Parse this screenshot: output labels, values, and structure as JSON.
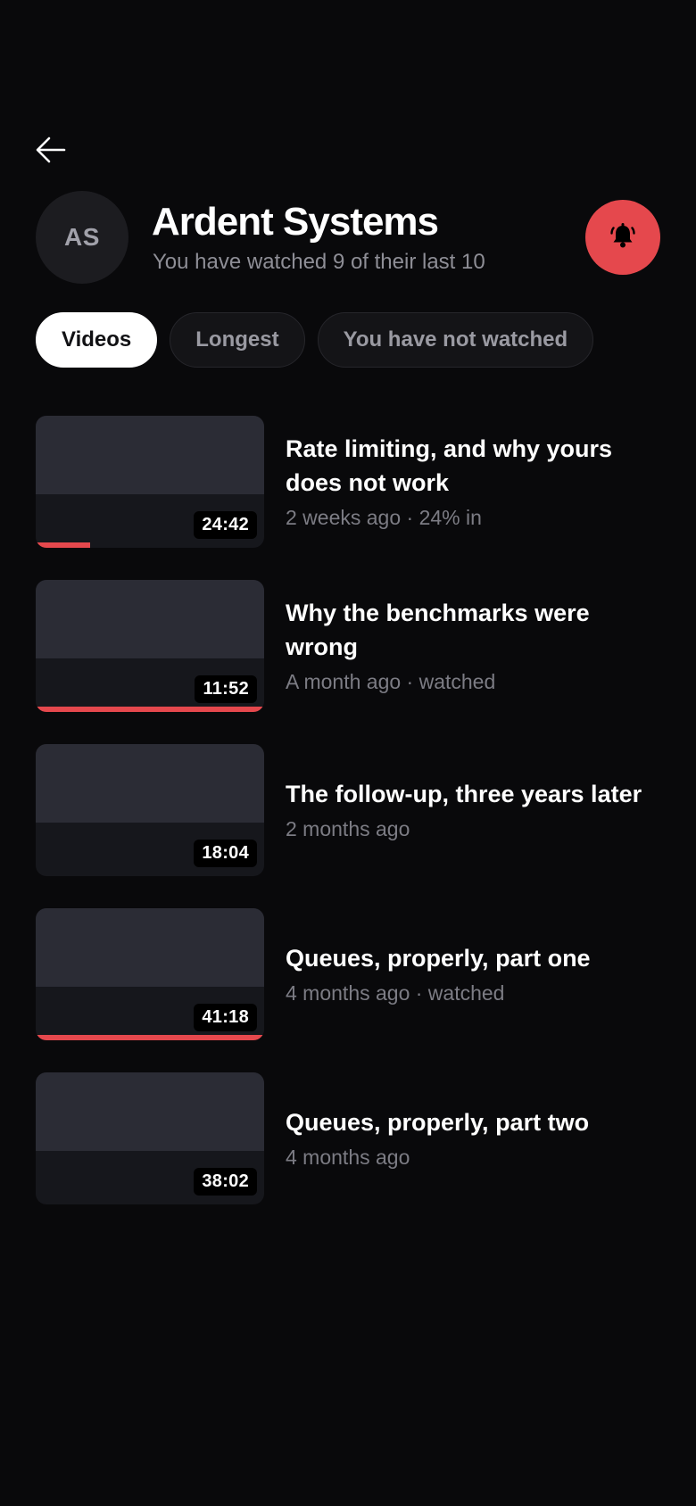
{
  "header": {
    "back_icon": "arrow-left-icon",
    "bell_icon": "bell-ringing-icon",
    "accent_color": "#e5484d"
  },
  "channel": {
    "initials": "AS",
    "name": "Ardent Systems",
    "subtitle": "You have watched 9 of their last 10"
  },
  "filters": {
    "chips": [
      {
        "label": "Videos",
        "active": true
      },
      {
        "label": "Longest",
        "active": false
      },
      {
        "label": "You have not watched",
        "active": false
      }
    ]
  },
  "videos": [
    {
      "title": "Rate limiting, and why yours does not work",
      "meta": "2 weeks ago · 24% in",
      "duration": "24:42",
      "progress": 0.24
    },
    {
      "title": "Why the benchmarks were wrong",
      "meta": "A month ago · watched",
      "duration": "11:52",
      "progress": 1.0
    },
    {
      "title": "The follow-up, three years later",
      "meta": "2 months ago",
      "duration": "18:04",
      "progress": 0
    },
    {
      "title": "Queues, properly, part one",
      "meta": "4 months ago · watched",
      "duration": "41:18",
      "progress": 1.0
    },
    {
      "title": "Queues, properly, part two",
      "meta": "4 months ago",
      "duration": "38:02",
      "progress": 0
    }
  ]
}
